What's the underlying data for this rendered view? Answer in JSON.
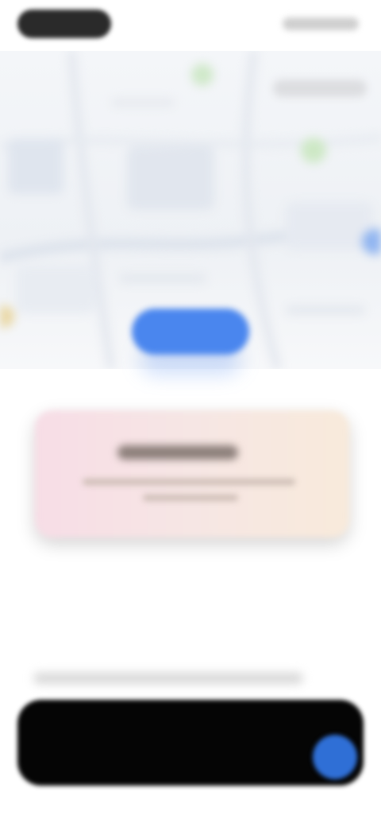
{
  "colors": {
    "accent": "#4a86ee",
    "fab": "#2f6fd6",
    "card_gradient_start": "#f7dde6",
    "card_gradient_end": "#f8eadb",
    "bottom_bar": "#050505"
  },
  "icons": {
    "map_marker": "location-pin-icon",
    "fab": "circle-button-icon"
  },
  "status_bar": {
    "time": "",
    "indicators": ""
  },
  "map": {
    "chip_label": "",
    "primary_button_label": ""
  },
  "card": {
    "title": "",
    "subtitle_line1": "",
    "subtitle_line2": ""
  },
  "bottom": {
    "section_label": "",
    "bar_label": ""
  }
}
